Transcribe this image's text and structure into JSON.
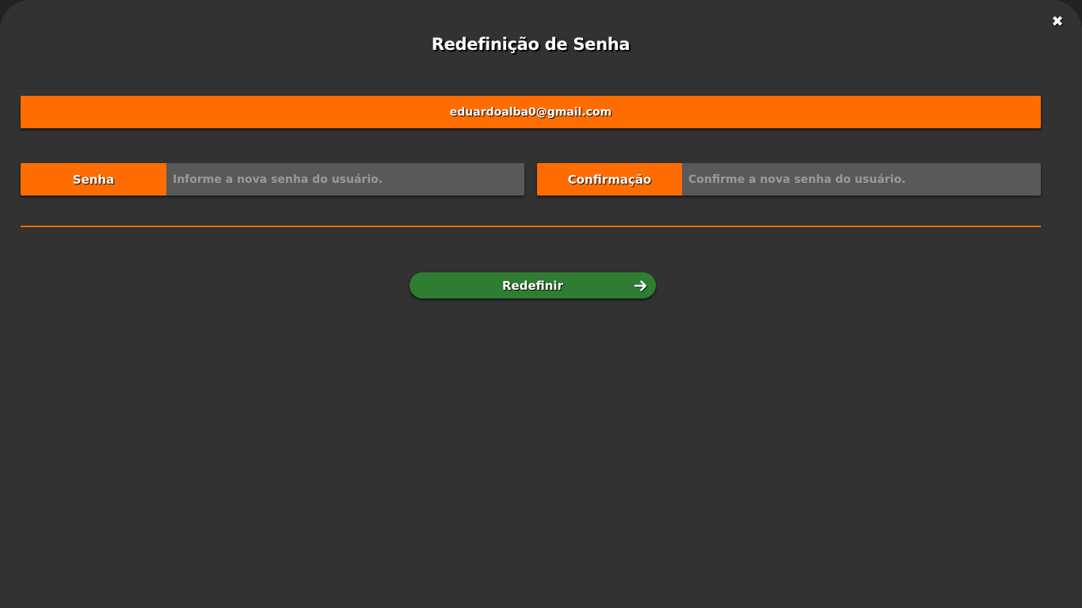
{
  "dialog": {
    "title": "Redefinição de Senha",
    "close_icon": "close-icon"
  },
  "email": "eduardoalba0@gmail.com",
  "fields": {
    "password": {
      "label": "Senha",
      "placeholder": "Informe a nova senha do usuário.",
      "value": ""
    },
    "confirmation": {
      "label": "Confirmação",
      "placeholder": "Confirme a nova senha do usuário.",
      "value": ""
    }
  },
  "submit": {
    "label": "Redefinir",
    "icon": "arrow-right-icon"
  },
  "colors": {
    "background": "#323232",
    "accent": "#ff6d00",
    "input_bg": "#595959",
    "submit_bg": "#2e7d32",
    "text": "#ffffff"
  }
}
